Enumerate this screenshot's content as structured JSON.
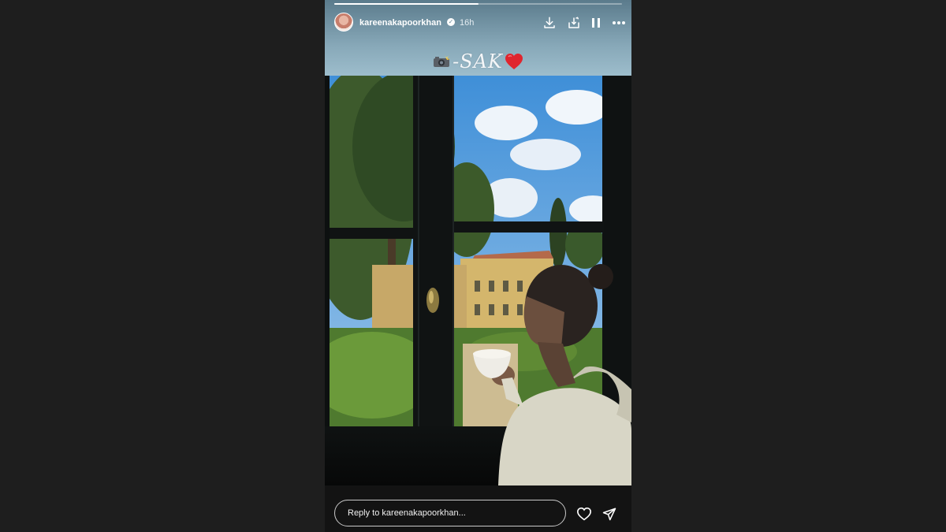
{
  "story": {
    "username": "kareenakapoorkhan",
    "verified": true,
    "time_ago": "16h",
    "progress_fraction": 0.5,
    "caption_text": "-SAK",
    "caption_camera_icon": "camera-flash-icon",
    "caption_heart_icon": "red-heart-icon"
  },
  "header_actions": [
    {
      "icon": "download-icon"
    },
    {
      "icon": "save-to-collection-icon"
    },
    {
      "icon": "pause-icon"
    },
    {
      "icon": "more-options-icon"
    }
  ],
  "reply": {
    "placeholder": "Reply to kareenakapoorkhan..."
  },
  "footer_actions": [
    {
      "icon": "heart-icon"
    },
    {
      "icon": "send-icon"
    }
  ],
  "colors": {
    "page_background": "#1e1e1e",
    "header_background": "#87a8b8",
    "accent_heart": "#e0252e"
  }
}
